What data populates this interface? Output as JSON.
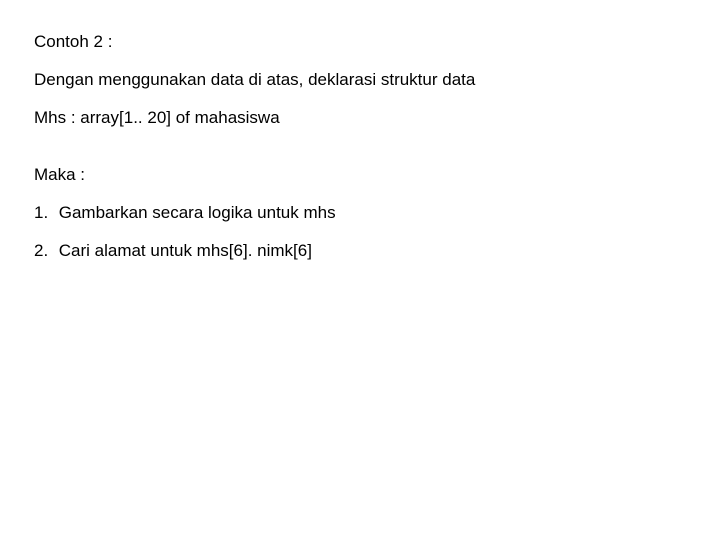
{
  "title": "Contoh 2 :",
  "lines": {
    "l1": "Dengan menggunakan data di atas, deklarasi struktur data",
    "l2": "Mhs : array[1.. 20] of mahasiswa",
    "l3": "Maka :"
  },
  "list": [
    {
      "num": "1.",
      "text": "Gambarkan secara logika untuk mhs"
    },
    {
      "num": "2.",
      "text": "Cari alamat untuk mhs[6]. nimk[6]"
    }
  ]
}
